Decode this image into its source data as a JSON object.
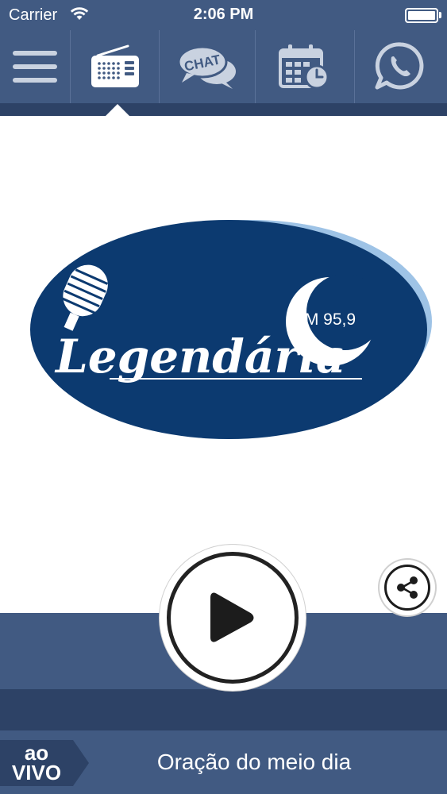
{
  "status_bar": {
    "carrier": "Carrier",
    "time": "2:06 PM"
  },
  "nav": {
    "items": [
      {
        "icon": "hamburger-menu-icon"
      },
      {
        "icon": "radio-icon",
        "selected": true
      },
      {
        "icon": "chat-bubbles-icon",
        "label": "CHAT"
      },
      {
        "icon": "calendar-clock-icon"
      },
      {
        "icon": "whatsapp-icon"
      }
    ]
  },
  "logo": {
    "name": "Legendária",
    "frequency": "FM 95,9"
  },
  "player": {
    "play_icon": "play-icon",
    "share_icon": "share-icon"
  },
  "now_playing": {
    "live_line1": "ao",
    "live_line2": "VIVO",
    "title": "Oração do meio dia"
  },
  "colors": {
    "header": "#415a82",
    "header_dark": "#2d4266",
    "logo_navy": "#0c3a70",
    "logo_light": "#9ec3e6"
  }
}
